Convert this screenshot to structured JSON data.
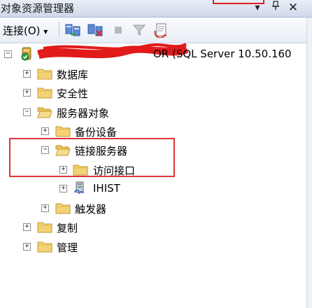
{
  "window": {
    "title": "对象资源管理器",
    "dropdown_icon": "dropdown-arrow-icon",
    "pin_icon": "pin-icon",
    "close_icon": "close-icon"
  },
  "toolbar": {
    "connect_label": "连接(O)",
    "connect_arrow": "▾",
    "icons": [
      "connect-icon",
      "disconnect-icon",
      "stop-icon",
      "filter-icon",
      "refresh-icon"
    ]
  },
  "tree": {
    "server": {
      "label": "OR (SQL Server 10.50.160",
      "expander": "⊟"
    },
    "nodes": {
      "databases": {
        "label": "数据库",
        "expander": "+"
      },
      "security": {
        "label": "安全性",
        "expander": "+"
      },
      "server_objects": {
        "label": "服务器对象",
        "expander": "−"
      },
      "backup_devices": {
        "label": "备份设备",
        "expander": "+"
      },
      "linked_servers": {
        "label": "链接服务器",
        "expander": "−"
      },
      "providers": {
        "label": "访问接口",
        "expander": "+"
      },
      "ihist": {
        "label": "IHIST",
        "expander": "+"
      },
      "triggers": {
        "label": "触发器",
        "expander": "+"
      },
      "replication": {
        "label": "复制",
        "expander": "+"
      },
      "management": {
        "label": "管理",
        "expander": "+"
      }
    }
  },
  "colors": {
    "folder": "#f3d277",
    "folder_edge": "#c49a2c",
    "annotation_red": "#d9363a"
  }
}
